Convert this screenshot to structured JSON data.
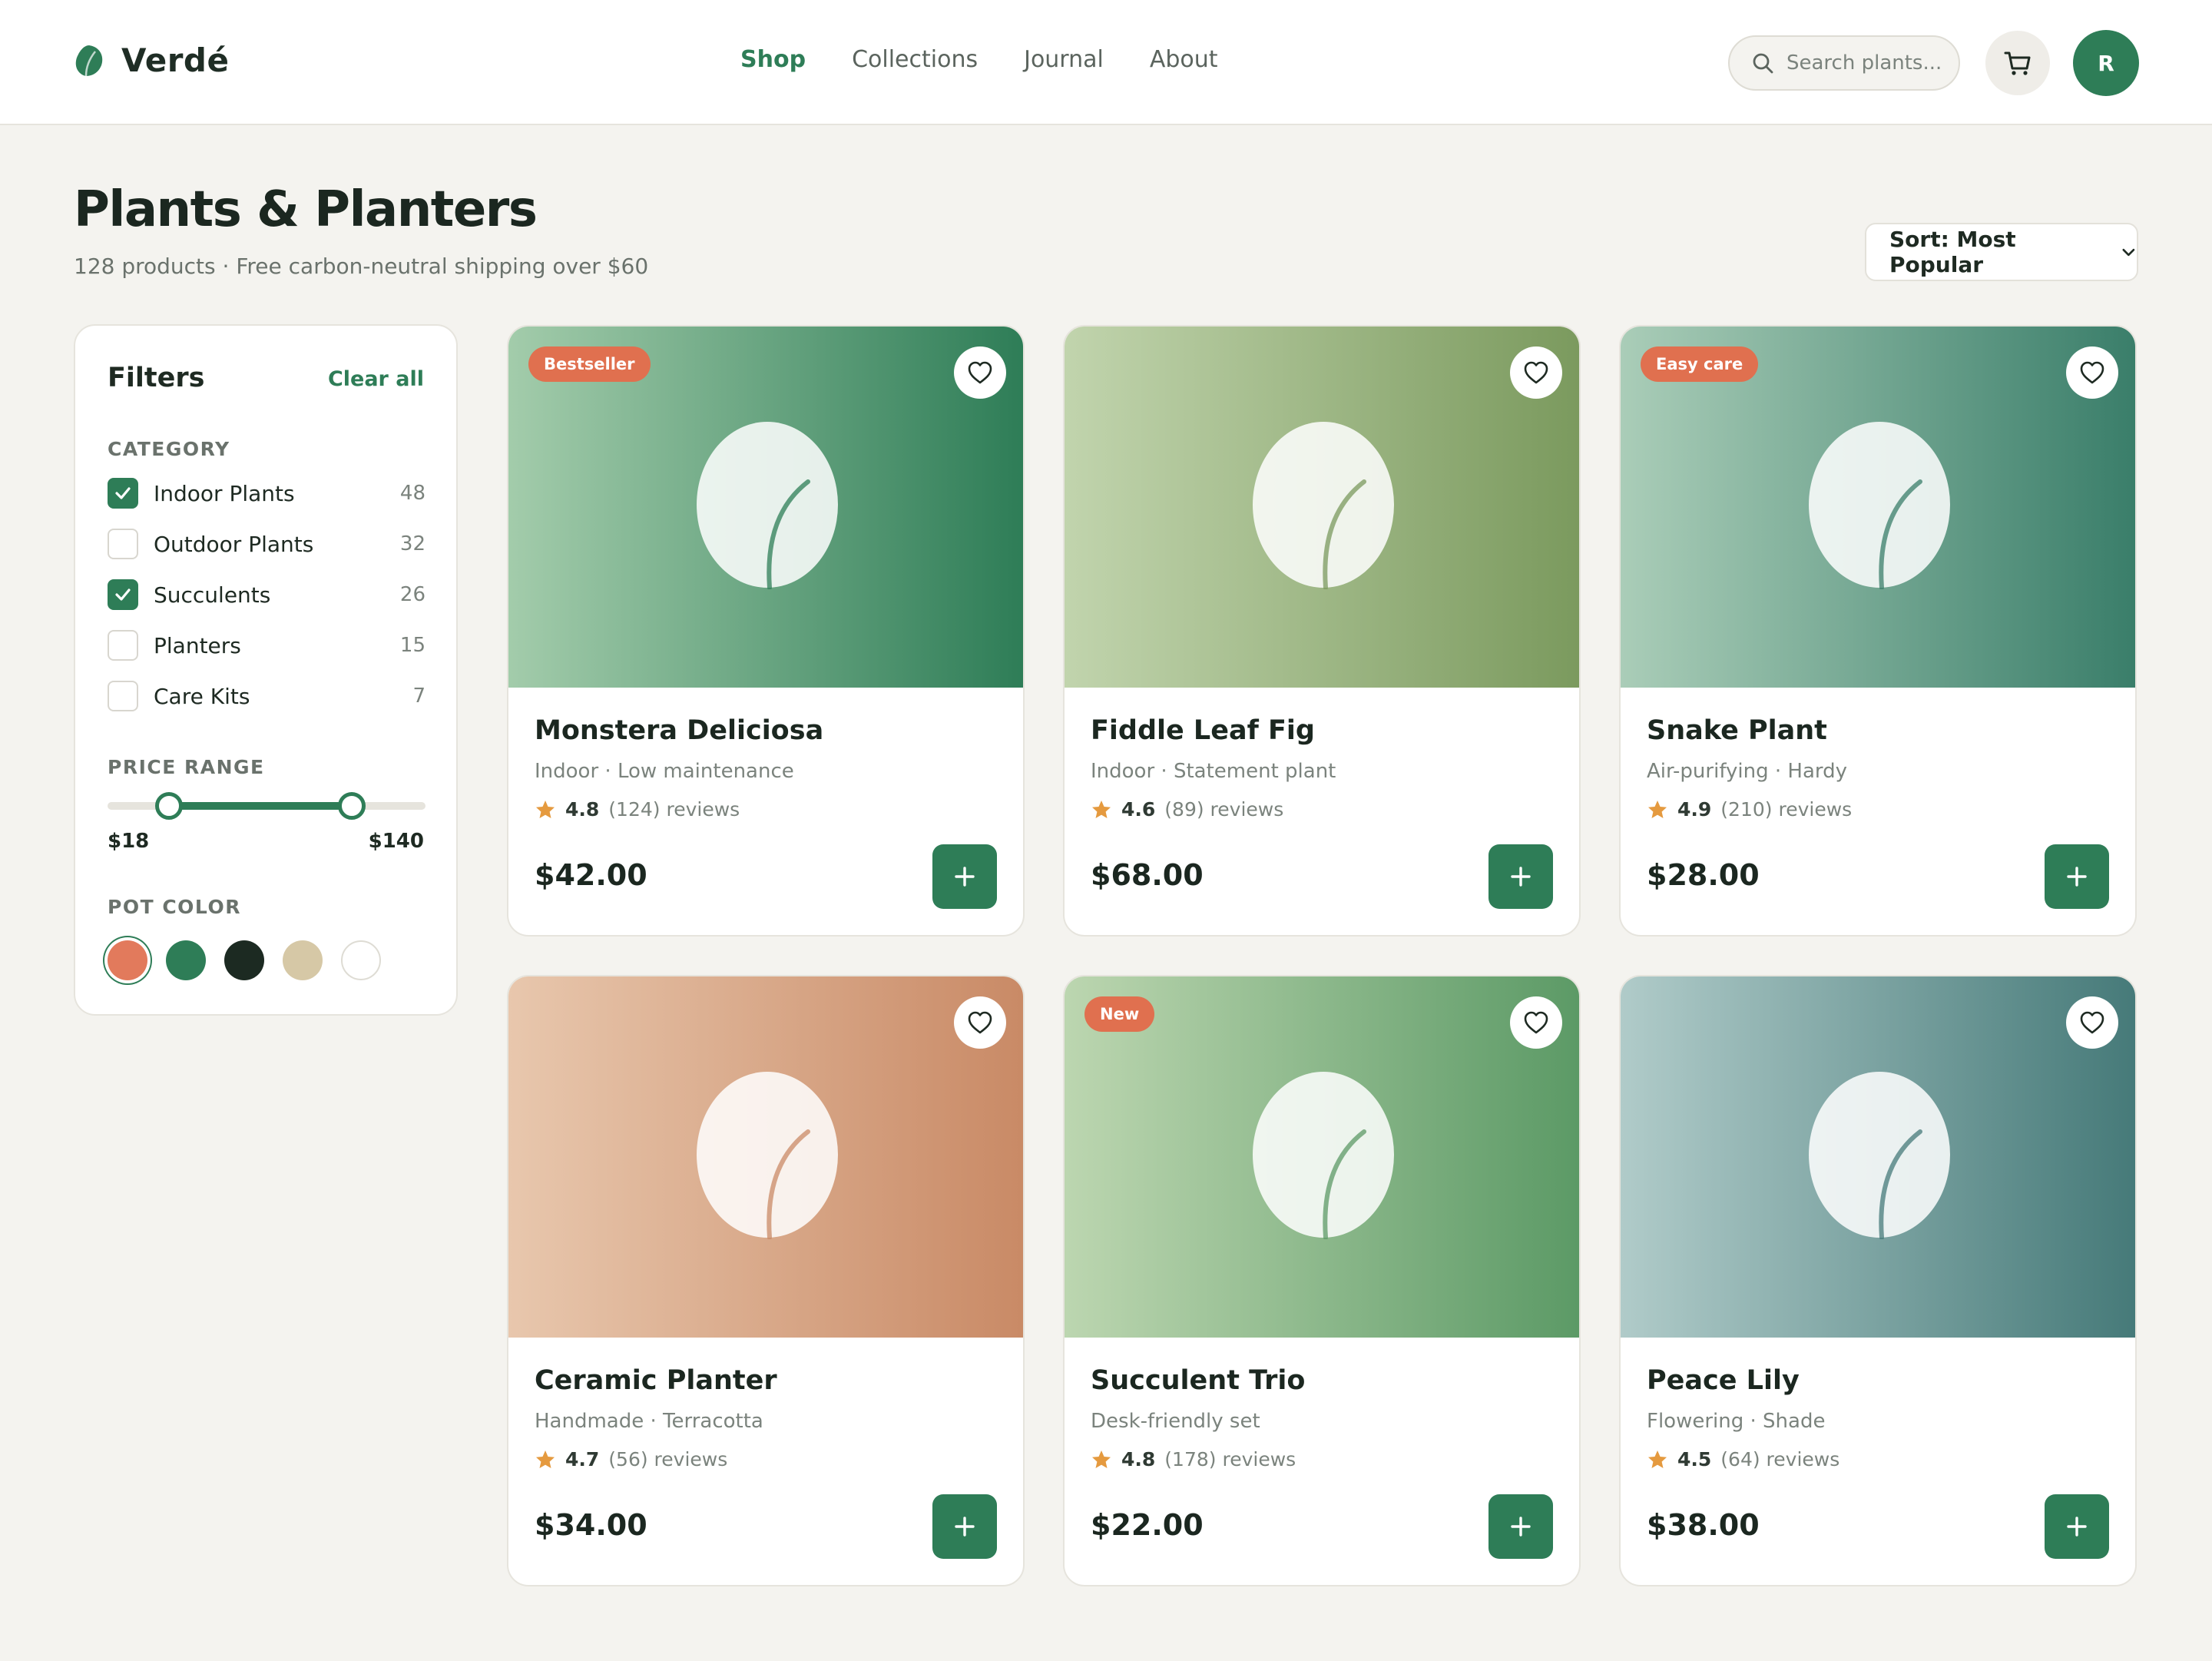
{
  "header": {
    "brand": "Verdé",
    "nav": [
      "Shop",
      "Collections",
      "Journal",
      "About"
    ],
    "active_nav": "Shop",
    "search_placeholder": "Search plants...",
    "avatar_initial": "R"
  },
  "page": {
    "title": "Plants & Planters",
    "subtitle": "128 products · Free carbon-neutral shipping over $60",
    "sort_label": "Sort: Most Popular"
  },
  "filters": {
    "title": "Filters",
    "clear_label": "Clear all",
    "category_heading": "CATEGORY",
    "categories": [
      {
        "label": "Indoor Plants",
        "count": "48",
        "checked": true
      },
      {
        "label": "Outdoor Plants",
        "count": "32",
        "checked": false
      },
      {
        "label": "Succulents",
        "count": "26",
        "checked": true
      },
      {
        "label": "Planters",
        "count": "15",
        "checked": false
      },
      {
        "label": "Care Kits",
        "count": "7",
        "checked": false
      }
    ],
    "price_heading": "PRICE RANGE",
    "price_min": "$18",
    "price_max": "$140",
    "color_heading": "POT COLOR",
    "pot_colors": [
      "#e27a5c",
      "#2e7d57",
      "#1c2a22",
      "#d6c8a6",
      "#ffffff"
    ],
    "selected_color": "#e27a5c"
  },
  "products": [
    {
      "name": "Monstera Deliciosa",
      "meta": "Indoor · Low maintenance",
      "rating": "4.8",
      "reviews": "(124) reviews",
      "price": "$42.00",
      "badge": "Bestseller",
      "gradient": [
        "#a3ccab",
        "#2e7d57"
      ]
    },
    {
      "name": "Fiddle Leaf Fig",
      "meta": "Indoor · Statement plant",
      "rating": "4.6",
      "reviews": "(89) reviews",
      "price": "$68.00",
      "badge": "",
      "gradient": [
        "#c1d4ad",
        "#7b9a5e"
      ]
    },
    {
      "name": "Snake Plant",
      "meta": "Air-purifying · Hardy",
      "rating": "4.9",
      "reviews": "(210) reviews",
      "price": "$28.00",
      "badge": "Easy care",
      "gradient": [
        "#aacdb8",
        "#3a7e6a"
      ]
    },
    {
      "name": "Ceramic Planter",
      "meta": "Handmade · Terracotta",
      "rating": "4.7",
      "reviews": "(56) reviews",
      "price": "$34.00",
      "badge": "",
      "gradient": [
        "#e8c7ad",
        "#c98a66"
      ]
    },
    {
      "name": "Succulent Trio",
      "meta": "Desk-friendly set",
      "rating": "4.8",
      "reviews": "(178) reviews",
      "price": "$22.00",
      "badge": "New",
      "gradient": [
        "#bcd6b0",
        "#5c9a66"
      ]
    },
    {
      "name": "Peace Lily",
      "meta": "Flowering · Shade",
      "rating": "4.5",
      "reviews": "(64) reviews",
      "price": "$38.00",
      "badge": "",
      "gradient": [
        "#b0cbc9",
        "#467a79"
      ]
    }
  ],
  "colors": {
    "accent": "#2e7d57",
    "badge": "#e0704f",
    "star": "#e59a3f",
    "background": "#f4f3ef"
  }
}
